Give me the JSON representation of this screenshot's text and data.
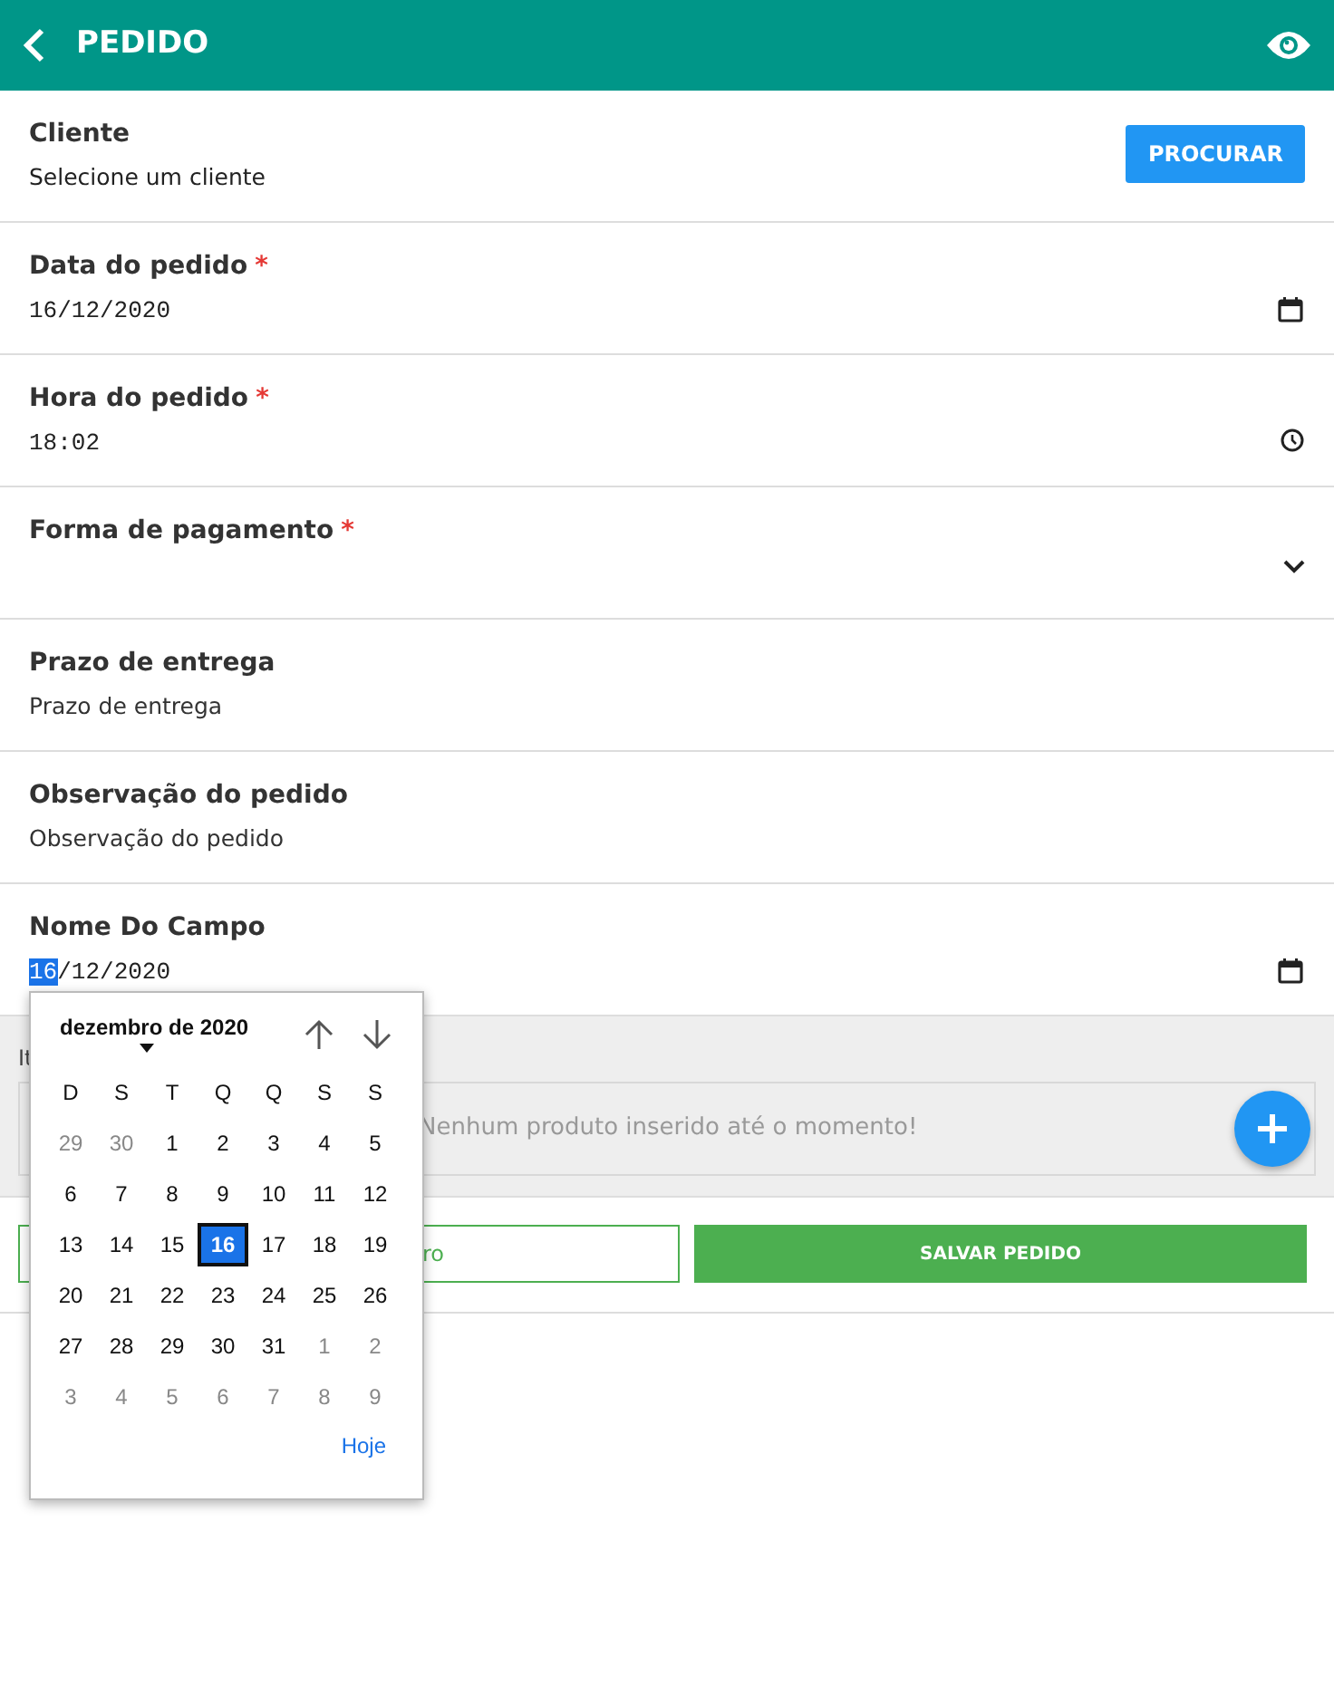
{
  "app_bar": {
    "title": "PEDIDO"
  },
  "fields": [
    {
      "kind": "picker",
      "label": "Cliente",
      "value": "Selecione um cliente",
      "button": "PROCURAR"
    },
    {
      "kind": "date",
      "label": "Data do pedido",
      "required_mark": "*",
      "value": "16/12/2020"
    },
    {
      "kind": "time",
      "label": "Hora do pedido",
      "required_mark": "*",
      "value": "18:02"
    },
    {
      "kind": "select",
      "label": "Forma de pagamento",
      "required_mark": "*"
    },
    {
      "kind": "text",
      "label": "Prazo de entrega",
      "placeholder": "Prazo de entrega"
    },
    {
      "kind": "text",
      "label": "Observação do pedido",
      "placeholder": "Observação do pedido"
    },
    {
      "kind": "date",
      "label": "Nome Do Campo",
      "value_parts": [
        {
          "text": "16",
          "selected": true
        },
        {
          "text": "/12/2020",
          "selected": false
        }
      ]
    }
  ],
  "items": {
    "label": "It",
    "empty_message": "Nenhum produto inserido até o momento!"
  },
  "actions": [
    {
      "kind": "outline",
      "label": "ro"
    },
    {
      "kind": "filled",
      "label": "SALVAR PEDIDO"
    }
  ],
  "calendar": {
    "month": "dezembro de 2020",
    "weekdays": [
      "D",
      "S",
      "T",
      "Q",
      "Q",
      "S",
      "S"
    ],
    "weeks": [
      [
        {
          "day": "29",
          "other_month": true,
          "selected": false
        },
        {
          "day": "30",
          "other_month": true,
          "selected": false
        },
        {
          "day": "1",
          "other_month": false,
          "selected": false
        },
        {
          "day": "2",
          "other_month": false,
          "selected": false
        },
        {
          "day": "3",
          "other_month": false,
          "selected": false
        },
        {
          "day": "4",
          "other_month": false,
          "selected": false
        },
        {
          "day": "5",
          "other_month": false,
          "selected": false
        }
      ],
      [
        {
          "day": "6",
          "other_month": false,
          "selected": false
        },
        {
          "day": "7",
          "other_month": false,
          "selected": false
        },
        {
          "day": "8",
          "other_month": false,
          "selected": false
        },
        {
          "day": "9",
          "other_month": false,
          "selected": false
        },
        {
          "day": "10",
          "other_month": false,
          "selected": false
        },
        {
          "day": "11",
          "other_month": false,
          "selected": false
        },
        {
          "day": "12",
          "other_month": false,
          "selected": false
        }
      ],
      [
        {
          "day": "13",
          "other_month": false,
          "selected": false
        },
        {
          "day": "14",
          "other_month": false,
          "selected": false
        },
        {
          "day": "15",
          "other_month": false,
          "selected": false
        },
        {
          "day": "16",
          "other_month": false,
          "selected": true
        },
        {
          "day": "17",
          "other_month": false,
          "selected": false
        },
        {
          "day": "18",
          "other_month": false,
          "selected": false
        },
        {
          "day": "19",
          "other_month": false,
          "selected": false
        }
      ],
      [
        {
          "day": "20",
          "other_month": false,
          "selected": false
        },
        {
          "day": "21",
          "other_month": false,
          "selected": false
        },
        {
          "day": "22",
          "other_month": false,
          "selected": false
        },
        {
          "day": "23",
          "other_month": false,
          "selected": false
        },
        {
          "day": "24",
          "other_month": false,
          "selected": false
        },
        {
          "day": "25",
          "other_month": false,
          "selected": false
        },
        {
          "day": "26",
          "other_month": false,
          "selected": false
        }
      ],
      [
        {
          "day": "27",
          "other_month": false,
          "selected": false
        },
        {
          "day": "28",
          "other_month": false,
          "selected": false
        },
        {
          "day": "29",
          "other_month": false,
          "selected": false
        },
        {
          "day": "30",
          "other_month": false,
          "selected": false
        },
        {
          "day": "31",
          "other_month": false,
          "selected": false
        },
        {
          "day": "1",
          "other_month": true,
          "selected": false
        },
        {
          "day": "2",
          "other_month": true,
          "selected": false
        }
      ],
      [
        {
          "day": "3",
          "other_month": true,
          "selected": false
        },
        {
          "day": "4",
          "other_month": true,
          "selected": false
        },
        {
          "day": "5",
          "other_month": true,
          "selected": false
        },
        {
          "day": "6",
          "other_month": true,
          "selected": false
        },
        {
          "day": "7",
          "other_month": true,
          "selected": false
        },
        {
          "day": "8",
          "other_month": true,
          "selected": false
        },
        {
          "day": "9",
          "other_month": true,
          "selected": false
        }
      ]
    ],
    "today": "Hoje"
  }
}
